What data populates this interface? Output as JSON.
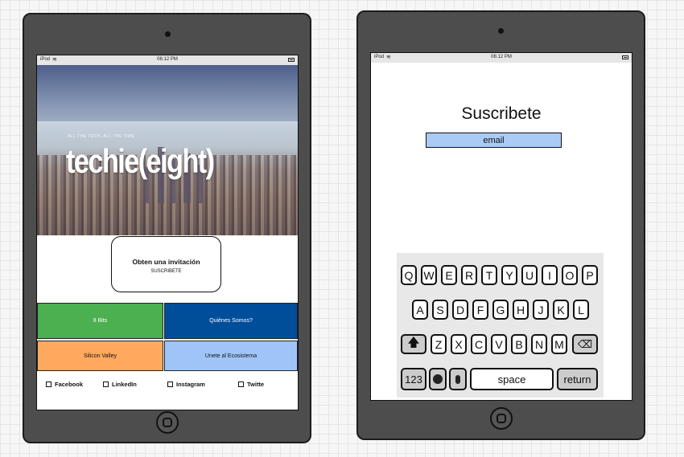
{
  "left_device": {
    "status": {
      "carrier": "iPod",
      "time": "06:12 PM"
    },
    "hero": {
      "tagline": "ALL THE TECH, ALL THE TIME",
      "logo": "techie(eight)"
    },
    "invite": {
      "title": "Obten una invitación",
      "action": "SUSCRIBETE"
    },
    "tiles": [
      {
        "label": "8 Bits",
        "color": "#4caf50",
        "text_color": "#ffffff"
      },
      {
        "label": "Quiénes Somos?",
        "color": "#004d99",
        "text_color": "#ffffff"
      },
      {
        "label": "Silicon  Valley",
        "color": "#ffa95e",
        "text_color": "#111111"
      },
      {
        "label": "Unete al Ecosistema",
        "color": "#9fc5f8",
        "text_color": "#111111"
      }
    ],
    "social": [
      "Facebook",
      "LinkedIn",
      "Instagram",
      "Twitte"
    ]
  },
  "right_device": {
    "status": {
      "carrier": "iPod",
      "time": "06:12 PM"
    },
    "title": "Suscribete",
    "email_label": "email",
    "keyboard": {
      "row1": [
        "Q",
        "W",
        "E",
        "R",
        "T",
        "Y",
        "U",
        "I",
        "O",
        "P"
      ],
      "row2": [
        "A",
        "S",
        "D",
        "F",
        "G",
        "H",
        "J",
        "K",
        "L"
      ],
      "row3": [
        "Z",
        "X",
        "C",
        "V",
        "B",
        "N",
        "M"
      ],
      "space": "space",
      "return": "return",
      "numbers": "123"
    }
  },
  "colors": {
    "email_field": "#a9cbf6",
    "tablet_body": "#4d4d4d"
  }
}
